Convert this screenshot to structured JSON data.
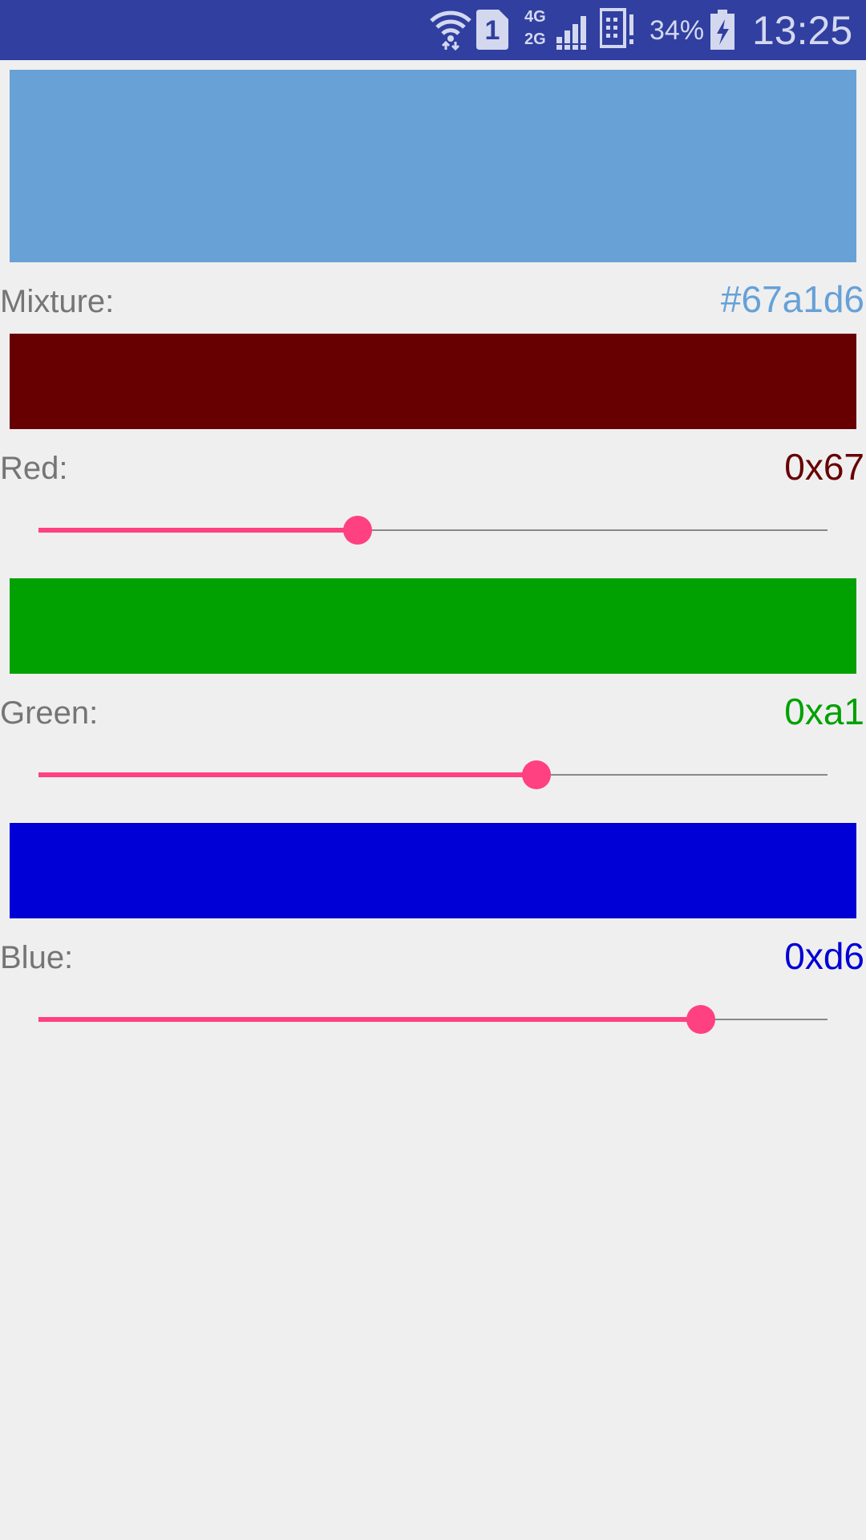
{
  "status_bar": {
    "sim_slot": "1",
    "network_4g": "4G",
    "network_2g": "2G",
    "battery_percent": "34%",
    "time": "13:25",
    "icons": [
      "wifi-icon",
      "sim-icon",
      "signal-icon",
      "device-icon",
      "battery-charging-icon"
    ]
  },
  "mixture": {
    "label": "Mixture:",
    "value": "#67a1d6",
    "color": "#67a1d6"
  },
  "channels": [
    {
      "name": "red",
      "label": "Red:",
      "value": "0x67",
      "level": 0.404,
      "color": "#670000",
      "text_color": "#670000"
    },
    {
      "name": "green",
      "label": "Green:",
      "value": "0xa1",
      "level": 0.631,
      "color": "#00a100",
      "text_color": "#00a100"
    },
    {
      "name": "blue",
      "label": "Blue:",
      "value": "0xd6",
      "level": 0.839,
      "color": "#0000d6",
      "text_color": "#0000d6"
    }
  ],
  "slider_accent_color": "#ff4081"
}
